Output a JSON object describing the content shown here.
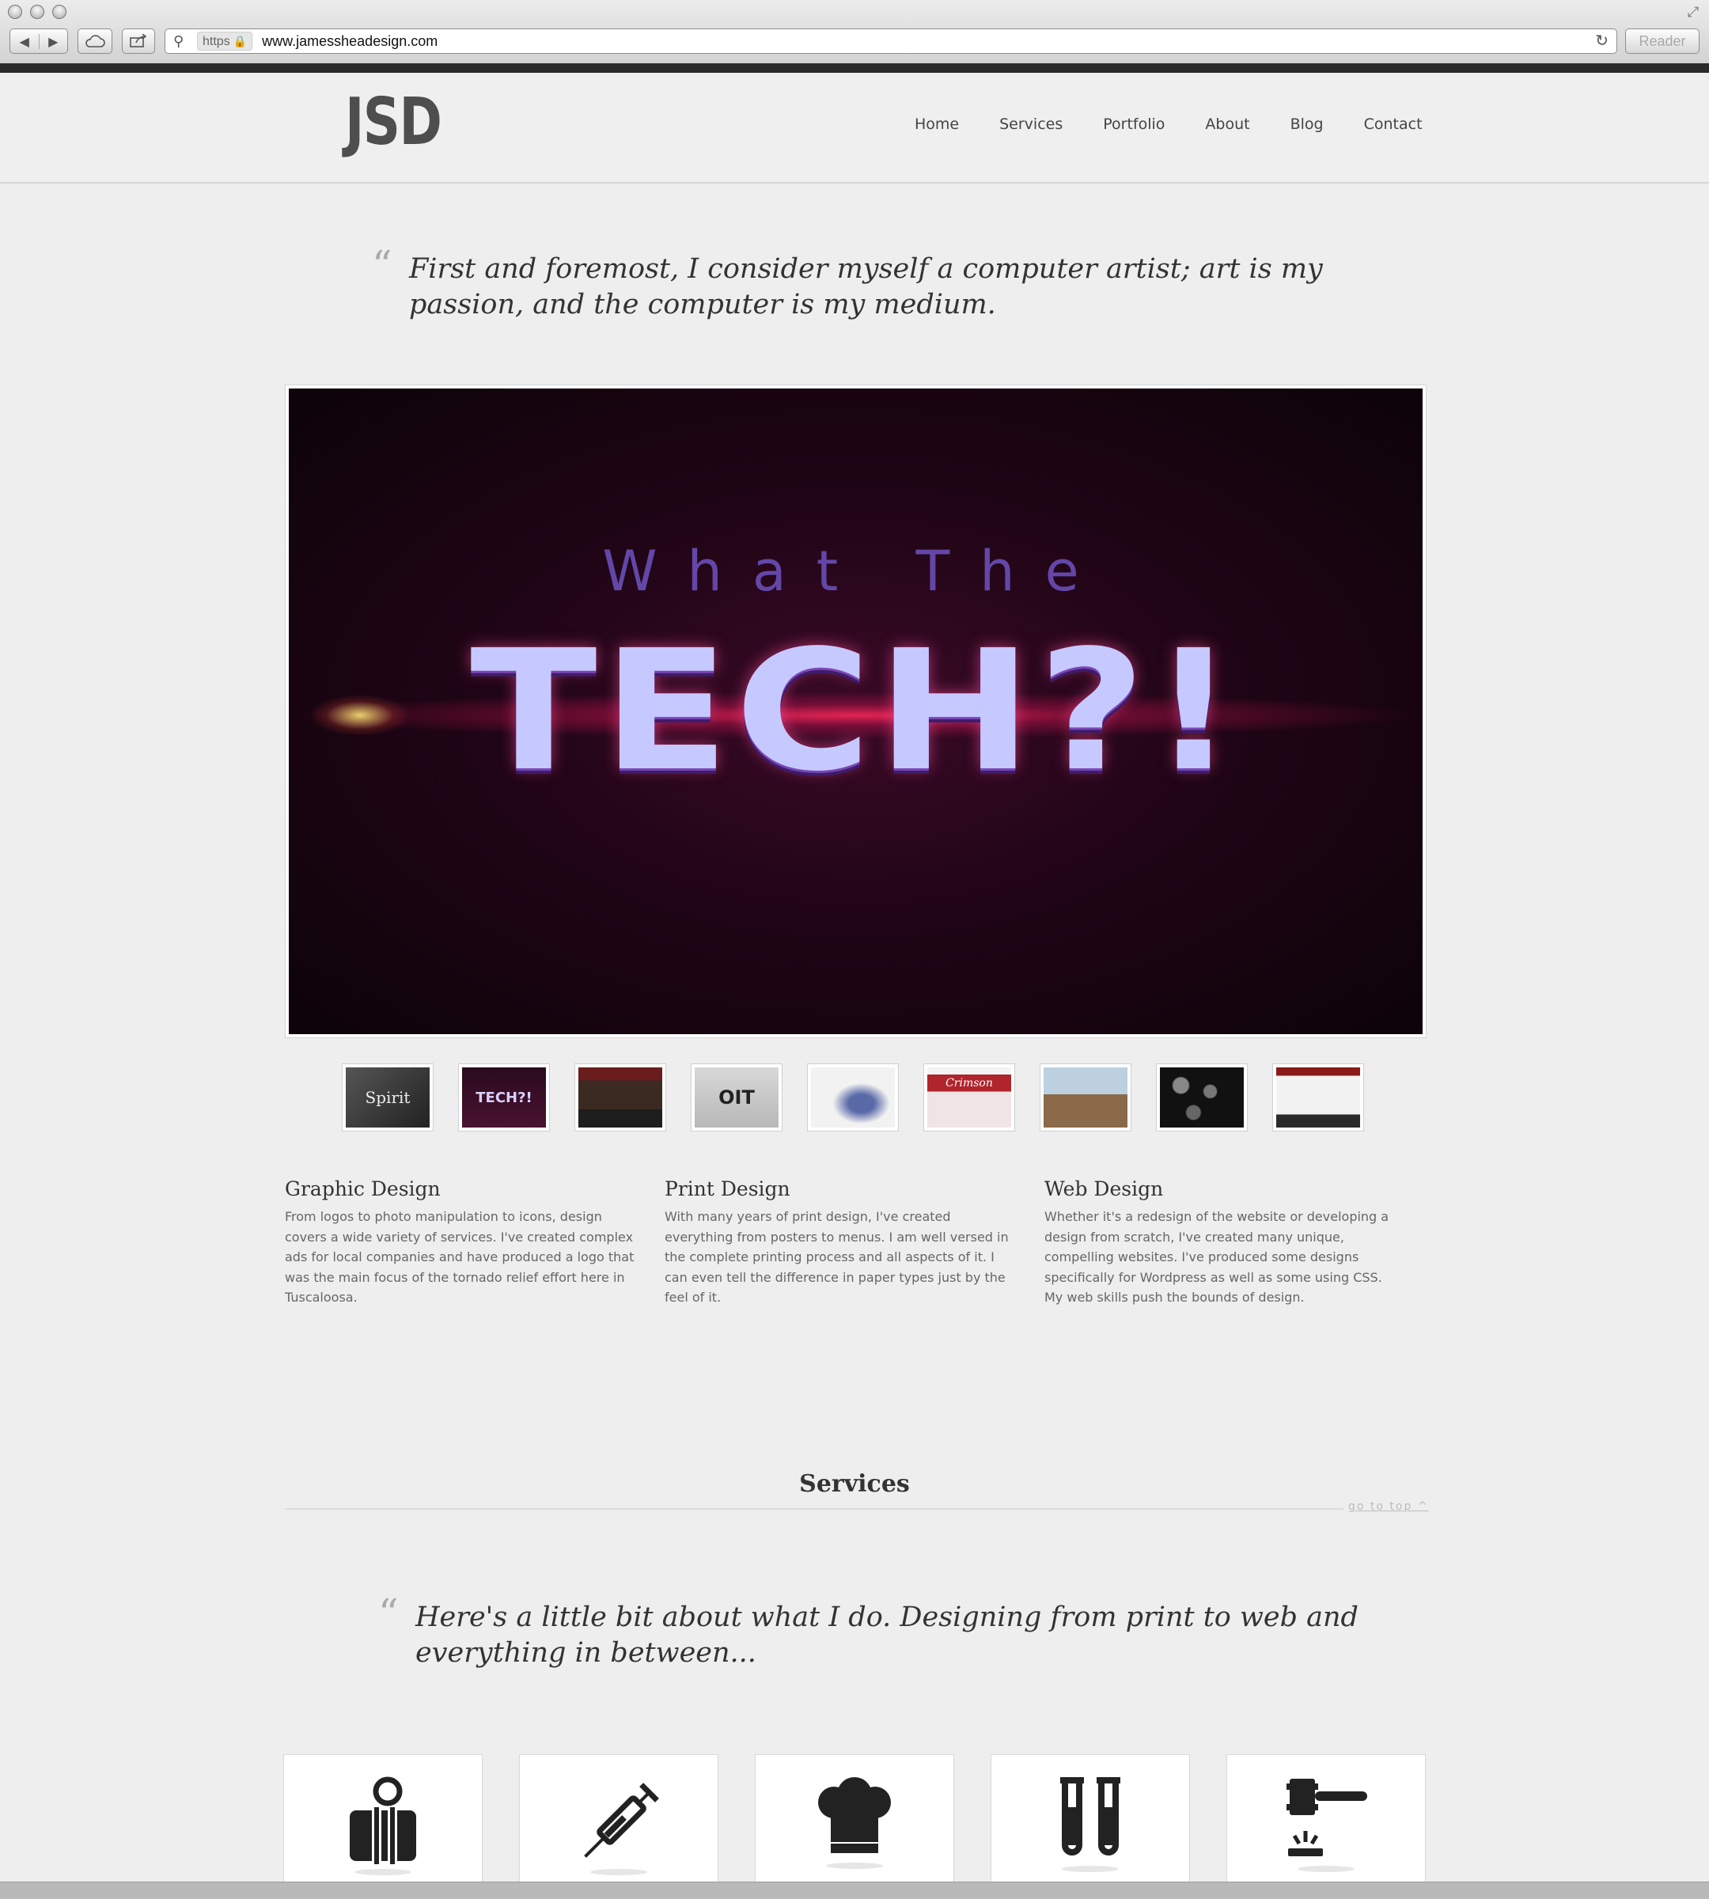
{
  "browser": {
    "protocol": "https",
    "url": "www.jamessheadesign.com",
    "reader_label": "Reader"
  },
  "site": {
    "logo_text": "JSD",
    "nav": [
      "Home",
      "Services",
      "Portfolio",
      "About",
      "Blog",
      "Contact"
    ]
  },
  "intro_quote": "First and foremost, I consider myself a computer artist; art is my passion, and the computer is my medium.",
  "slider": {
    "small_text": "What The",
    "big_text": "TECH?!",
    "thumbnails": [
      "Spirit",
      "TECH?!",
      "",
      "OIT",
      "",
      "Crimson",
      "",
      "",
      ""
    ]
  },
  "features": [
    {
      "title": "Graphic Design",
      "text": "From logos to photo manipulation to icons, design covers a wide variety of services. I've created complex ads for local companies and have produced a logo that was the main focus of the tornado relief effort here in Tuscaloosa."
    },
    {
      "title": "Print Design",
      "text": "With many years of print design, I've created everything from posters to menus. I am well versed in the complete printing process and all aspects of it. I can even tell the difference in paper types just by the feel of it."
    },
    {
      "title": "Web Design",
      "text": "Whether it's a redesign of the website or developing a design from scratch, I've created many unique, compelling websites. I've produced some designs specifically for Wordpress as well as some using CSS. My web skills push the bounds of design."
    }
  ],
  "services": {
    "title": "Services",
    "go_to_top": "go to top",
    "quote": "Here's a little bit about what I do. Designing from print to web and everything in between...",
    "icons": [
      "briefcase-magnifier-icon",
      "syringe-icon",
      "chef-hat-icon",
      "test-tubes-icon",
      "gavel-icon"
    ]
  },
  "colors": {
    "page_bg": "#eeeeee",
    "hero_bg": "#200516",
    "hero_text": "#c6c9ff",
    "icon": "#222222"
  }
}
